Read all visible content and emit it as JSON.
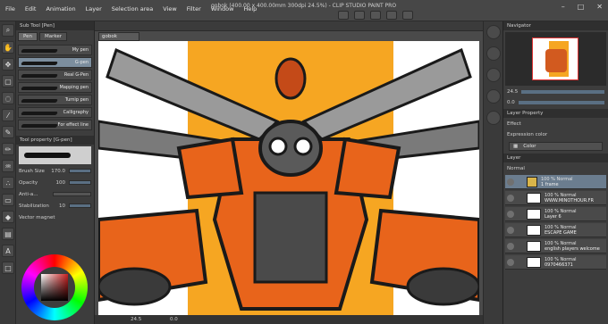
{
  "menubar": {
    "items": [
      "File",
      "Edit",
      "Animation",
      "Layer",
      "Selection area",
      "View",
      "Filter",
      "Window",
      "Help"
    ],
    "title": "gobok (400.00 x 400.00mm 300dpi 24.5%) - CLIP STUDIO PAINT PRO"
  },
  "subtool": {
    "panel_title": "Sub Tool [Pen]",
    "tabs": [
      "Pen",
      "Marker"
    ],
    "brushes": [
      "My pen",
      "G-pen",
      "Real G-Pen",
      "Mapping pen",
      "Turnip pen",
      "Calligraphy",
      "For effect line"
    ],
    "selected_brush_index": 1
  },
  "tool_property": {
    "title": "Tool property [G-pen]",
    "preview_label": "G-pen",
    "brush_size_label": "Brush Size",
    "brush_size_value": "170.0",
    "opacity_label": "Opacity",
    "opacity_value": "100",
    "aa_label": "Anti-a...",
    "stabilization_label": "Stabilization",
    "stabilization_value": "10",
    "vector_magnet_label": "Vector magnet"
  },
  "canvas": {
    "doc_tab": "gobok",
    "zoom": "24.5",
    "status_coords": "0.0"
  },
  "navigator": {
    "title": "Navigator",
    "zoom_value": "24.5",
    "rotation_value": "0.0"
  },
  "layer_property": {
    "title": "Layer Property",
    "effect_label": "Effect",
    "expression_label": "Expression color",
    "color_value": "Color"
  },
  "layers": {
    "title": "Layer",
    "blend_mode": "Normal",
    "items": [
      {
        "pct": "100 % Normal",
        "name": "1 frame",
        "folder": true
      },
      {
        "pct": "100 % Normal",
        "name": "WWW.MINOTHOUR.FR",
        "folder": false
      },
      {
        "pct": "100 % Normal",
        "name": "Layer 6",
        "folder": false
      },
      {
        "pct": "100 % Normal",
        "name": "ESCAPE GAME",
        "folder": false
      },
      {
        "pct": "100 % Normal",
        "name": "english players welcome",
        "folder": false
      },
      {
        "pct": "100 % Normal",
        "name": "0970466371",
        "folder": false
      }
    ],
    "selected_index": 0
  },
  "colors": {
    "accent_orange": "#e8641b",
    "background_yellow": "#f6a622",
    "selection_blue": "#6b7d8f"
  }
}
